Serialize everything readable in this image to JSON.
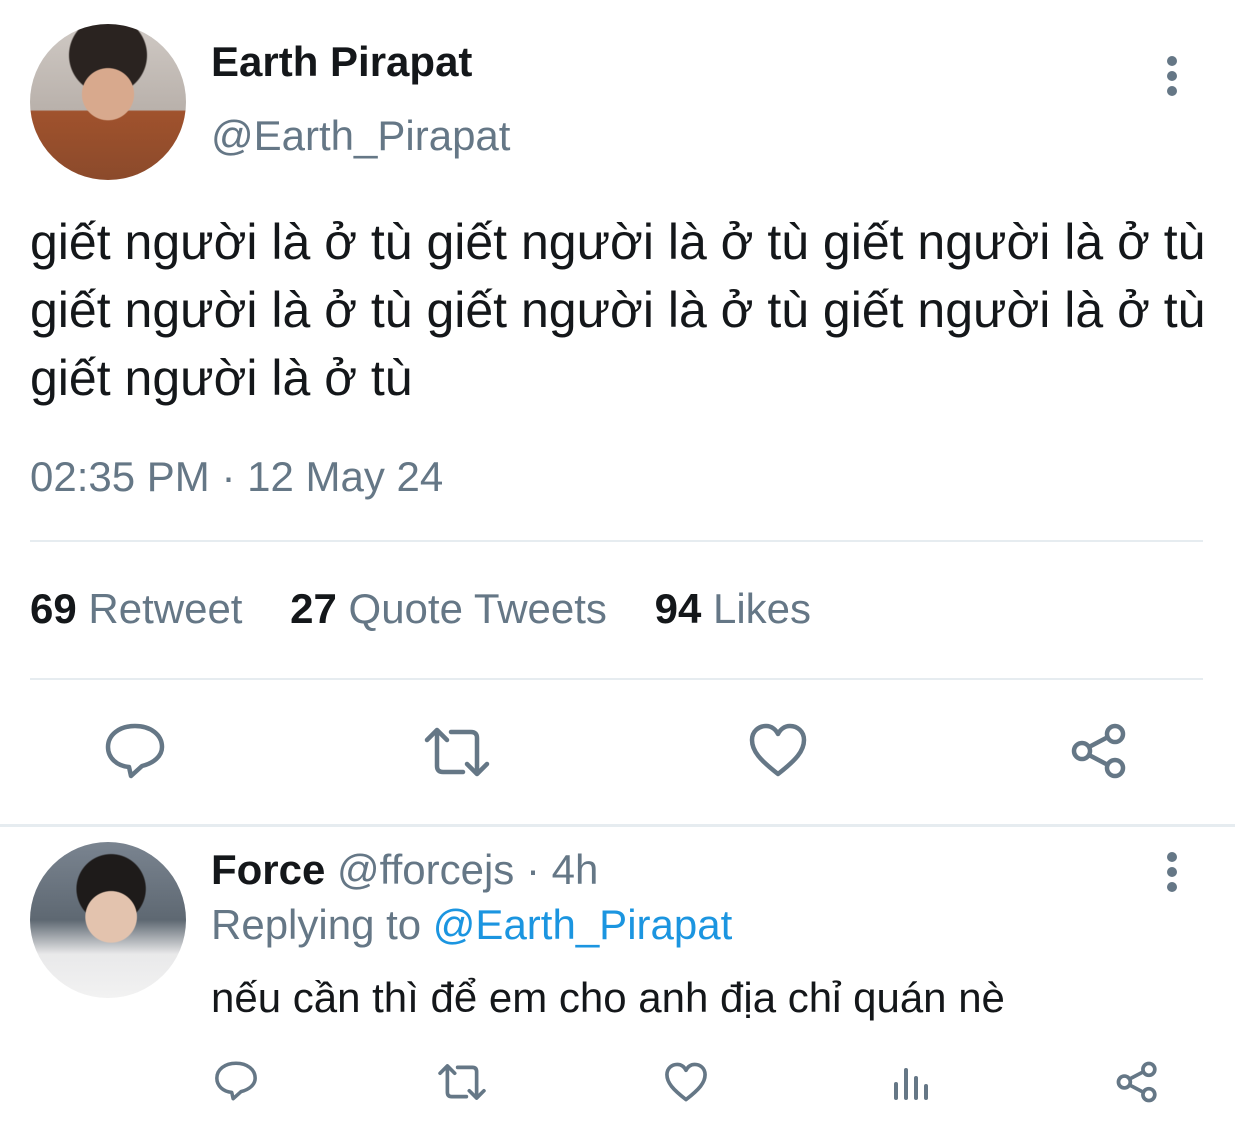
{
  "tweet": {
    "author_name": "Earth Pirapat",
    "author_handle": "@Earth_Pirapat",
    "text": "giết người là ở tù giết người là ở tù giết người là ở tù giết người là ở tù giết người là ở tù giết người là ở tù giết người là ở tù",
    "timestamp": "02:35 PM · 12 May 24",
    "stats": {
      "retweets_count": "69",
      "retweets_label": "Retweet",
      "quotes_count": "27",
      "quotes_label": "Quote Tweets",
      "likes_count": "94",
      "likes_label": "Likes"
    }
  },
  "reply": {
    "author_name": "Force",
    "author_handle": "@fforcejs",
    "time_ago": "· 4h",
    "replying_to_label": "Replying to",
    "replying_to_handle": "@Earth_Pirapat",
    "text": "nếu cần thì để em cho anh địa chỉ quán nè"
  },
  "icons": {
    "action_color": "#657786",
    "link_color": "#1b95e0"
  }
}
